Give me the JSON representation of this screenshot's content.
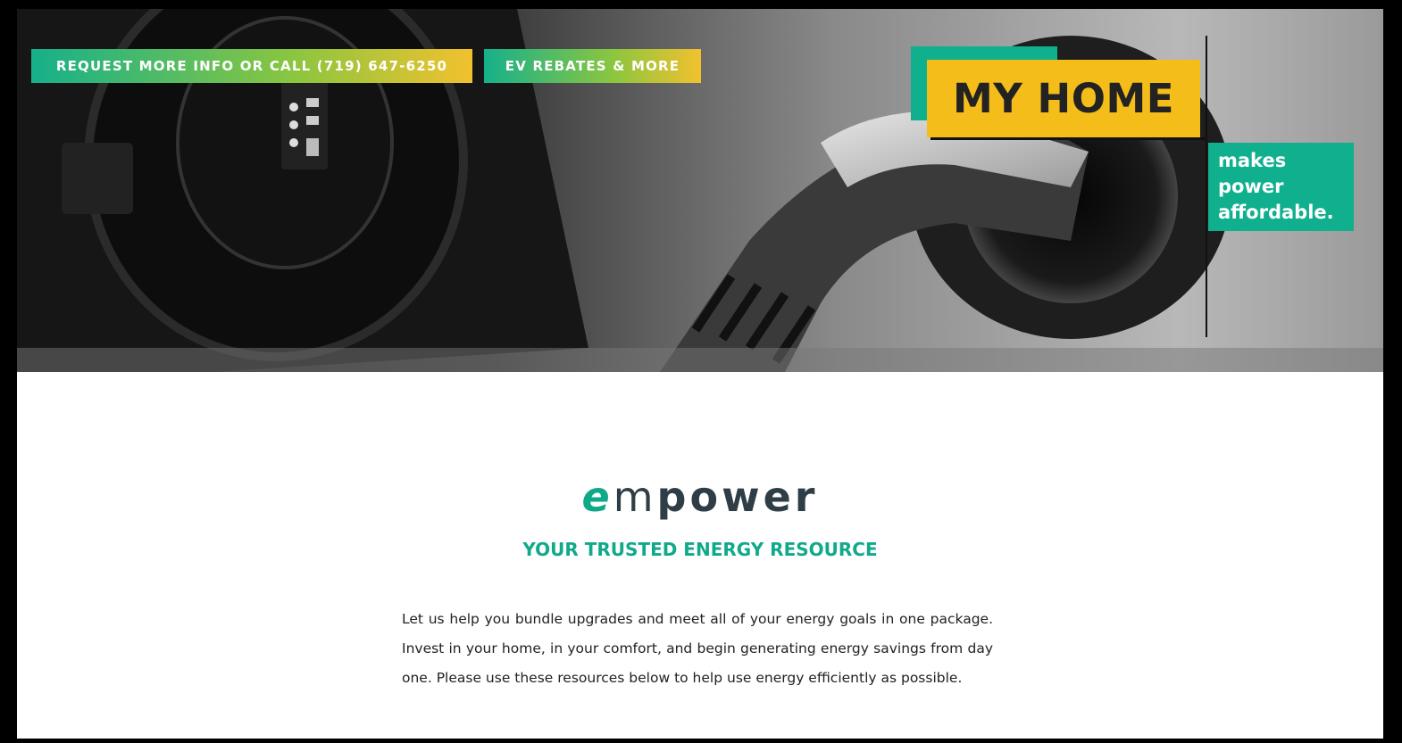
{
  "hero": {
    "cta_request": "REQUEST MORE INFO OR CALL (719) 647-6250",
    "cta_rebates": "EV REBATES & MORE",
    "brand_title": "MY HOME",
    "brand_tag_lines": [
      "makes",
      "power",
      "affordable."
    ],
    "photo_subject": "ev-charger-plug-photo"
  },
  "logo": {
    "e": "e",
    "m": "m",
    "rest": "power"
  },
  "tagline": "YOUR TRUSTED ENERGY RESOURCE",
  "intro": "Let us help you bundle upgrades and meet all of your energy goals in one package. Invest in your home, in your comfort, and begin generating energy savings from day one. Please use these resources below to help use energy efficiently as possible.",
  "colors": {
    "teal": "#10b08e",
    "yellow": "#f4bd1a",
    "dark": "#2f3e46"
  }
}
